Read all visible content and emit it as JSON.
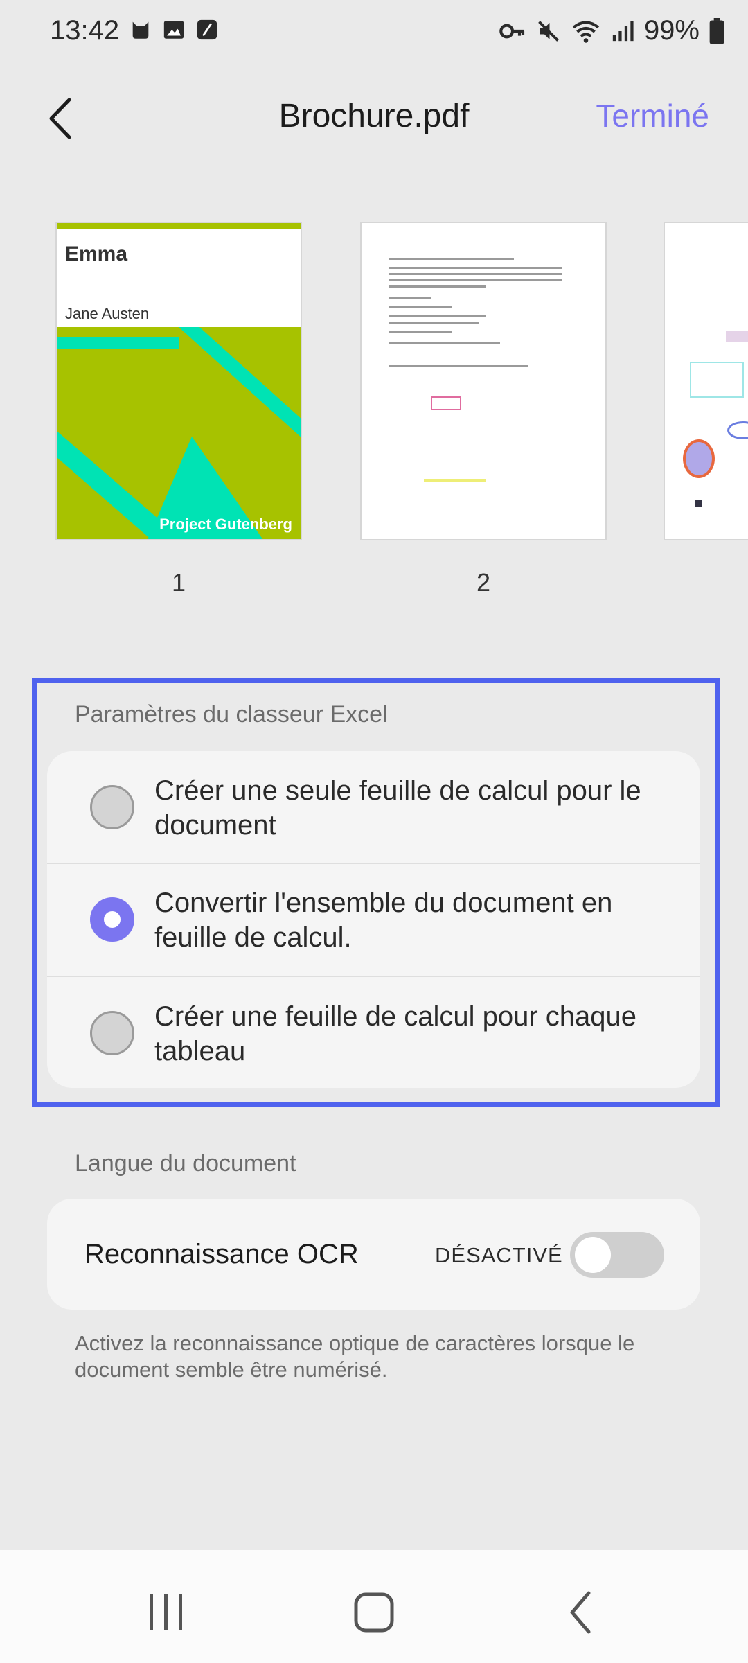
{
  "status_bar": {
    "time": "13:42",
    "battery": "99%",
    "icons": [
      "cat-icon",
      "image-icon",
      "feather-icon",
      "key-icon",
      "mute-icon",
      "wifi-icon",
      "signal-icon",
      "battery-icon"
    ]
  },
  "header": {
    "title": "Brochure.pdf",
    "done_label": "Terminé"
  },
  "thumbnails": [
    {
      "number": "1",
      "cover_title": "Emma",
      "cover_author": "Jane Austen",
      "cover_publisher": "Project Gutenberg"
    },
    {
      "number": "2"
    },
    {
      "number": ""
    }
  ],
  "excel": {
    "section_label": "Paramètres du classeur Excel",
    "options": [
      {
        "label": "Créer une seule feuille de calcul pour le document",
        "selected": false
      },
      {
        "label": "Convertir l'ensemble du document en feuille de calcul.",
        "selected": true
      },
      {
        "label": "Créer une feuille de calcul pour chaque tableau",
        "selected": false
      }
    ]
  },
  "language": {
    "section_label": "Langue du document",
    "ocr_label": "Reconnaissance OCR",
    "ocr_state": "DÉSACTIVÉ",
    "ocr_enabled": false,
    "help_text": "Activez la reconnaissance optique de caractères lorsque le document semble être numérisé."
  },
  "colors": {
    "accent": "#7b75f0",
    "highlight_frame": "#4f62ee",
    "cover_green": "#a7c200",
    "cover_teal": "#00e3b4"
  }
}
